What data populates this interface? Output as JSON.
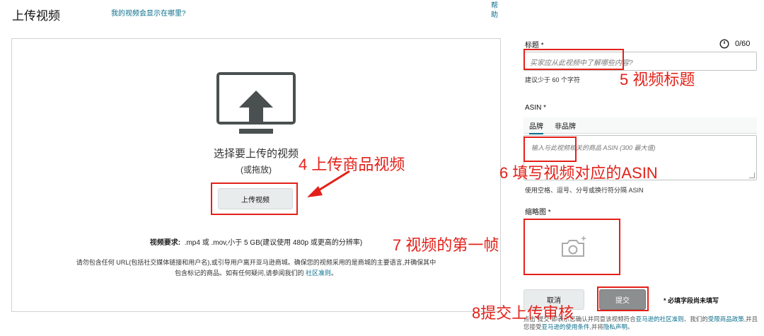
{
  "header": {
    "title": "上传视频",
    "where_link": "我的视频会显示在哪里?",
    "help_link": "帮助"
  },
  "upload_area": {
    "choose_text": "选择要上传的视频",
    "drag_text": "(或拖放)",
    "upload_button": "上传视频",
    "requirements_label": "视频要求:",
    "requirements_text": ".mp4 或 .mov,小于 5 GB(建议使用 480p 或更高的分辨率)",
    "notice_text": "请勿包含任何 URL(包括社交媒体链接和用户名),或引导用户离开亚马逊商城。确保您的视频采用的是商城的主要语言,并确保其中包含标记的商品。如有任何疑问,请参阅我们的",
    "notice_link": "社区准则",
    "notice_end": "。"
  },
  "form": {
    "title_label": "标题 *",
    "title_counter": "0/60",
    "title_placeholder": "买家应从此视频中了解哪些内容?",
    "title_hint": "建议少于 60 个字符",
    "asin_label": "ASIN *",
    "tabs": [
      {
        "label": "品牌",
        "active": true
      },
      {
        "label": "非品牌",
        "active": false
      }
    ],
    "asin_placeholder": "输入与此视频相关的商品 ASIN (300 最大值)",
    "asin_hint": "使用空格、逗号、分号或换行符分隔 ASIN",
    "thumbnail_label": "缩略图 *",
    "cancel_button": "取消",
    "submit_button": "提交",
    "required_note": "* 必填字段尚未填写",
    "terms_part1": "点击“提交”即表示您确认并同意该视频符合",
    "terms_link1": "亚马逊的社区准则",
    "terms_part2": "、我们的",
    "terms_link2": "受限商品政策",
    "terms_part3": ",并且您接受",
    "terms_link3": "亚马逊的使用条件",
    "terms_part4": ",并将",
    "terms_link4": "隐私声明",
    "terms_part5": "。"
  },
  "annotations": {
    "step4": "4 上传商品视频",
    "step5": "5 视频标题",
    "step6": "6 填写视频对应的ASIN",
    "step7": "7 视频的第一帧",
    "step8": "8提交上传审核"
  },
  "colors": {
    "annotation_red": "#e32119",
    "link_teal": "#0a6f8c"
  },
  "icons": {
    "upload": "monitor-upload-icon",
    "timer": "timer-icon",
    "camera": "camera-icon"
  }
}
